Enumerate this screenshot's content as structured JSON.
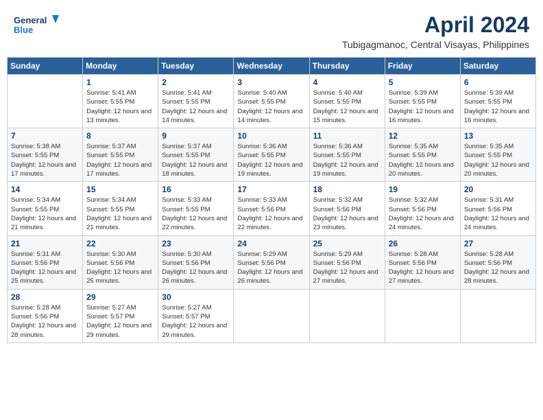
{
  "logo": {
    "line1": "General",
    "line2": "Blue"
  },
  "title": "April 2024",
  "location": "Tubigagmanoc, Central Visayas, Philippines",
  "weekdays": [
    "Sunday",
    "Monday",
    "Tuesday",
    "Wednesday",
    "Thursday",
    "Friday",
    "Saturday"
  ],
  "weeks": [
    [
      {
        "day": "",
        "sunrise": "",
        "sunset": "",
        "daylight": ""
      },
      {
        "day": "1",
        "sunrise": "Sunrise: 5:41 AM",
        "sunset": "Sunset: 5:55 PM",
        "daylight": "Daylight: 12 hours and 13 minutes."
      },
      {
        "day": "2",
        "sunrise": "Sunrise: 5:41 AM",
        "sunset": "Sunset: 5:55 PM",
        "daylight": "Daylight: 12 hours and 14 minutes."
      },
      {
        "day": "3",
        "sunrise": "Sunrise: 5:40 AM",
        "sunset": "Sunset: 5:55 PM",
        "daylight": "Daylight: 12 hours and 14 minutes."
      },
      {
        "day": "4",
        "sunrise": "Sunrise: 5:40 AM",
        "sunset": "Sunset: 5:55 PM",
        "daylight": "Daylight: 12 hours and 15 minutes."
      },
      {
        "day": "5",
        "sunrise": "Sunrise: 5:39 AM",
        "sunset": "Sunset: 5:55 PM",
        "daylight": "Daylight: 12 hours and 16 minutes."
      },
      {
        "day": "6",
        "sunrise": "Sunrise: 5:39 AM",
        "sunset": "Sunset: 5:55 PM",
        "daylight": "Daylight: 12 hours and 16 minutes."
      }
    ],
    [
      {
        "day": "7",
        "sunrise": "Sunrise: 5:38 AM",
        "sunset": "Sunset: 5:55 PM",
        "daylight": "Daylight: 12 hours and 17 minutes."
      },
      {
        "day": "8",
        "sunrise": "Sunrise: 5:37 AM",
        "sunset": "Sunset: 5:55 PM",
        "daylight": "Daylight: 12 hours and 17 minutes."
      },
      {
        "day": "9",
        "sunrise": "Sunrise: 5:37 AM",
        "sunset": "Sunset: 5:55 PM",
        "daylight": "Daylight: 12 hours and 18 minutes."
      },
      {
        "day": "10",
        "sunrise": "Sunrise: 5:36 AM",
        "sunset": "Sunset: 5:55 PM",
        "daylight": "Daylight: 12 hours and 19 minutes."
      },
      {
        "day": "11",
        "sunrise": "Sunrise: 5:36 AM",
        "sunset": "Sunset: 5:55 PM",
        "daylight": "Daylight: 12 hours and 19 minutes."
      },
      {
        "day": "12",
        "sunrise": "Sunrise: 5:35 AM",
        "sunset": "Sunset: 5:55 PM",
        "daylight": "Daylight: 12 hours and 20 minutes."
      },
      {
        "day": "13",
        "sunrise": "Sunrise: 5:35 AM",
        "sunset": "Sunset: 5:55 PM",
        "daylight": "Daylight: 12 hours and 20 minutes."
      }
    ],
    [
      {
        "day": "14",
        "sunrise": "Sunrise: 5:34 AM",
        "sunset": "Sunset: 5:55 PM",
        "daylight": "Daylight: 12 hours and 21 minutes."
      },
      {
        "day": "15",
        "sunrise": "Sunrise: 5:34 AM",
        "sunset": "Sunset: 5:55 PM",
        "daylight": "Daylight: 12 hours and 21 minutes."
      },
      {
        "day": "16",
        "sunrise": "Sunrise: 5:33 AM",
        "sunset": "Sunset: 5:55 PM",
        "daylight": "Daylight: 12 hours and 22 minutes."
      },
      {
        "day": "17",
        "sunrise": "Sunrise: 5:33 AM",
        "sunset": "Sunset: 5:56 PM",
        "daylight": "Daylight: 12 hours and 22 minutes."
      },
      {
        "day": "18",
        "sunrise": "Sunrise: 5:32 AM",
        "sunset": "Sunset: 5:56 PM",
        "daylight": "Daylight: 12 hours and 23 minutes."
      },
      {
        "day": "19",
        "sunrise": "Sunrise: 5:32 AM",
        "sunset": "Sunset: 5:56 PM",
        "daylight": "Daylight: 12 hours and 24 minutes."
      },
      {
        "day": "20",
        "sunrise": "Sunrise: 5:31 AM",
        "sunset": "Sunset: 5:56 PM",
        "daylight": "Daylight: 12 hours and 24 minutes."
      }
    ],
    [
      {
        "day": "21",
        "sunrise": "Sunrise: 5:31 AM",
        "sunset": "Sunset: 5:56 PM",
        "daylight": "Daylight: 12 hours and 25 minutes."
      },
      {
        "day": "22",
        "sunrise": "Sunrise: 5:30 AM",
        "sunset": "Sunset: 5:56 PM",
        "daylight": "Daylight: 12 hours and 25 minutes."
      },
      {
        "day": "23",
        "sunrise": "Sunrise: 5:30 AM",
        "sunset": "Sunset: 5:56 PM",
        "daylight": "Daylight: 12 hours and 26 minutes."
      },
      {
        "day": "24",
        "sunrise": "Sunrise: 5:29 AM",
        "sunset": "Sunset: 5:56 PM",
        "daylight": "Daylight: 12 hours and 26 minutes."
      },
      {
        "day": "25",
        "sunrise": "Sunrise: 5:29 AM",
        "sunset": "Sunset: 5:56 PM",
        "daylight": "Daylight: 12 hours and 27 minutes."
      },
      {
        "day": "26",
        "sunrise": "Sunrise: 5:28 AM",
        "sunset": "Sunset: 5:56 PM",
        "daylight": "Daylight: 12 hours and 27 minutes."
      },
      {
        "day": "27",
        "sunrise": "Sunrise: 5:28 AM",
        "sunset": "Sunset: 5:56 PM",
        "daylight": "Daylight: 12 hours and 28 minutes."
      }
    ],
    [
      {
        "day": "28",
        "sunrise": "Sunrise: 5:28 AM",
        "sunset": "Sunset: 5:56 PM",
        "daylight": "Daylight: 12 hours and 28 minutes."
      },
      {
        "day": "29",
        "sunrise": "Sunrise: 5:27 AM",
        "sunset": "Sunset: 5:57 PM",
        "daylight": "Daylight: 12 hours and 29 minutes."
      },
      {
        "day": "30",
        "sunrise": "Sunrise: 5:27 AM",
        "sunset": "Sunset: 5:57 PM",
        "daylight": "Daylight: 12 hours and 29 minutes."
      },
      {
        "day": "",
        "sunrise": "",
        "sunset": "",
        "daylight": ""
      },
      {
        "day": "",
        "sunrise": "",
        "sunset": "",
        "daylight": ""
      },
      {
        "day": "",
        "sunrise": "",
        "sunset": "",
        "daylight": ""
      },
      {
        "day": "",
        "sunrise": "",
        "sunset": "",
        "daylight": ""
      }
    ]
  ]
}
